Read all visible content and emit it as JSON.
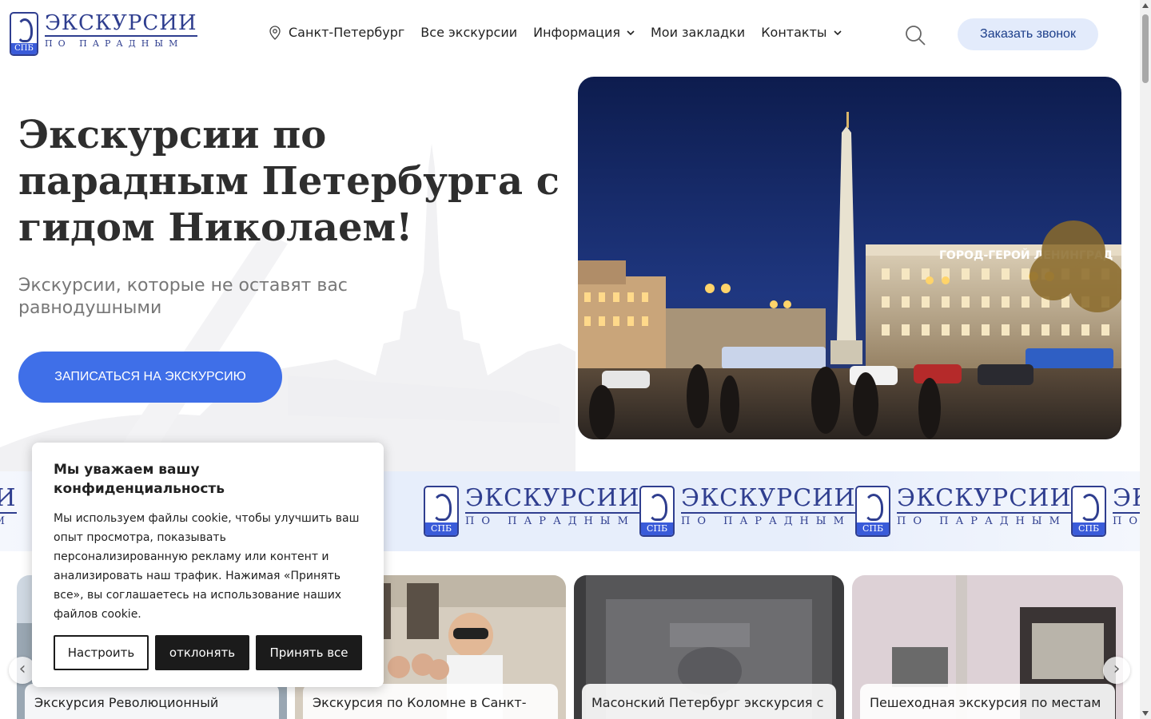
{
  "brand": {
    "title": "ЭКСКУРСИИ",
    "subtitle": "ПО ПАРАДНЫМ",
    "badge": "СПБ",
    "primary_color": "#2f3e8f",
    "accent_color": "#3f6fe8"
  },
  "nav": {
    "city": "Санкт-Петербург",
    "items": [
      {
        "label": "Все экскурсии"
      },
      {
        "label": "Информация"
      },
      {
        "label": "Мои закладки"
      },
      {
        "label": "Контакты"
      }
    ],
    "callback_label": "Заказать звонок"
  },
  "hero": {
    "title": "Экскурсии по парадным Петербурга с гидом Николаем!",
    "subtitle": "Экскурсии, которые не оставят вас равнодушными",
    "cta_label": "ЗАПИСАТЬСЯ НА ЭКСКУРСИЮ",
    "photo_sign": "ГОРОД-ГЕРОЙ ЛЕНИНГРАД"
  },
  "cards": [
    {
      "title": "Экскурсия Революционный"
    },
    {
      "title": "Экскурсия по Коломне в Санкт-"
    },
    {
      "title": "Масонский Петербург экскурсия с"
    },
    {
      "title": "Пешеходная экскурсия по местам"
    }
  ],
  "carousel": {
    "prev_icon": "chevron-left-icon",
    "next_icon": "chevron-right-icon"
  },
  "cookie": {
    "title": "Мы уважаем вашу конфиденциальность",
    "text": "Мы используем файлы cookie, чтобы улучшить ваш опыт просмотра, показывать персонализированную рекламу или контент и анализировать наш трафик. Нажимая «Принять все», вы соглашаетесь на использование наших файлов cookie.",
    "customize_label": "Настроить",
    "reject_label": "отклонять",
    "accept_label": "Принять все"
  }
}
